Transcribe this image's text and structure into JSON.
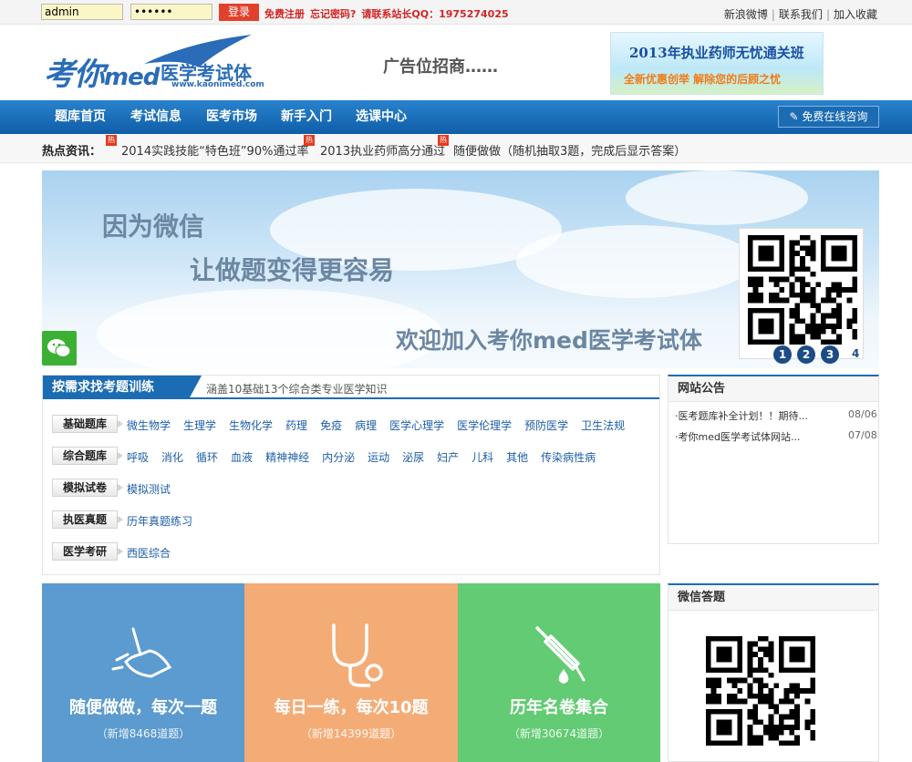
{
  "topbar": {
    "username_value": "admin",
    "password_value": "••••••",
    "login_label": "登录",
    "free_register": "免费注册",
    "forgot_password": "忘记密码?",
    "contact_admin": "请联系站长QQ：1975274025",
    "links": [
      "新浪微博",
      "联系我们",
      "加入收藏"
    ]
  },
  "header": {
    "logo_text": "考你",
    "logo_med": "med",
    "logo_cn": "医学考试体",
    "logo_url": "www.kaonimed.com",
    "ad_text": "广告位招商……",
    "ad_banner_line1": "2013年执业药师无忧通关班",
    "ad_banner_line2": "全新优惠创举  解除您的后顾之忧"
  },
  "nav": {
    "items": [
      "题库首页",
      "考试信息",
      "医考市场",
      "新手入门",
      "选课中心"
    ],
    "consult_label": "免费在线咨询"
  },
  "hot": {
    "label": "热点资讯：",
    "badge": "热",
    "items": [
      "2014实践技能“特色班”90%通过率",
      "2013执业药师高分通过",
      "随便做做（随机抽取3题，完成后显示答案）"
    ]
  },
  "banner": {
    "line1": "因为微信",
    "line2": "让做题变得更容易",
    "line3": "欢迎加入考你med医学考试体",
    "dots": [
      "1",
      "2",
      "3",
      "4"
    ]
  },
  "search": {
    "tab_label": "按需求找考题训练",
    "subtitle": "涵盖10基础13个综合类专业医学知识",
    "rows": [
      {
        "label": "基础题库",
        "items": [
          "微生物学",
          "生理学",
          "生物化学",
          "药理",
          "免疫",
          "病理",
          "医学心理学",
          "医学伦理学",
          "预防医学",
          "卫生法规"
        ]
      },
      {
        "label": "综合题库",
        "items": [
          "呼吸",
          "消化",
          "循环",
          "血液",
          "精神神经",
          "内分泌",
          "运动",
          "泌尿",
          "妇产",
          "儿科",
          "其他",
          "传染病性病"
        ]
      },
      {
        "label": "模拟试卷",
        "items": [
          "模拟测试"
        ]
      },
      {
        "label": "执医真题",
        "items": [
          "历年真题练习"
        ]
      },
      {
        "label": "医学考研",
        "items": [
          "西医综合"
        ]
      }
    ]
  },
  "notices": {
    "title": "网站公告",
    "items": [
      {
        "text": "·医考题库补全计划！！期待...",
        "date": "08/06"
      },
      {
        "text": "·考你med医学考试体网站...",
        "date": "07/08"
      }
    ]
  },
  "wechat_panel": {
    "title": "微信答题"
  },
  "tiles": [
    {
      "title": "随便做做，每次一题",
      "sub": "（新增8468道题）",
      "color": "#5b9bd0"
    },
    {
      "title": "每日一练，每次10题",
      "sub": "（新增14399道题）",
      "color": "#f4ac77"
    },
    {
      "title": "历年名卷集合",
      "sub": "（新增30674道题）",
      "color": "#62cb73"
    }
  ]
}
